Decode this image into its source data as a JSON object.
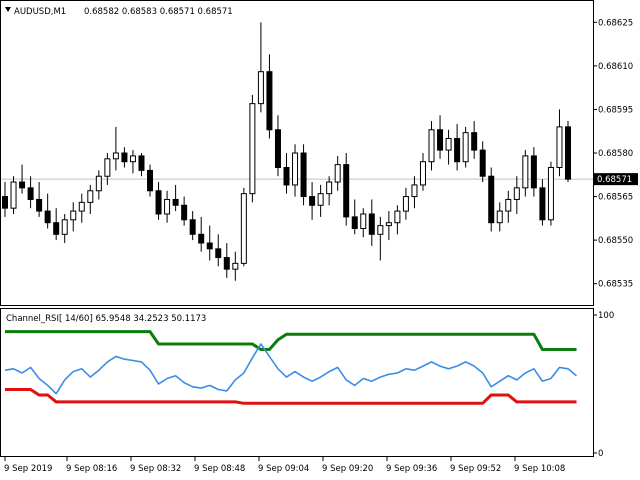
{
  "main": {
    "symbol": "AUDUSD,M1",
    "ohlc": "0.68582 0.68583 0.68571 0.68571",
    "price_axis": [
      "0.68625",
      "0.68610",
      "0.68595",
      "0.68580",
      "0.68565",
      "0.68550",
      "0.68535"
    ],
    "current_price": "0.68571",
    "ylim": [
      0.68528,
      0.68632
    ],
    "current_price_value": 0.68571
  },
  "indicator": {
    "title": "Channel_RSI[ 14/60] 65.9548 34.2523 50.1173",
    "axis_top": "100",
    "axis_bottom": "0",
    "colors": {
      "rsi": "#3a8ee6",
      "upper": "#0a7d0a",
      "lower": "#e01010"
    }
  },
  "time_axis": [
    "9 Sep 2019",
    "9 Sep 08:16",
    "9 Sep 08:32",
    "9 Sep 08:48",
    "9 Sep 09:04",
    "9 Sep 09:20",
    "9 Sep 09:36",
    "9 Sep 09:52",
    "9 Sep 10:08"
  ],
  "chart_data": [
    {
      "type": "candlestick",
      "series": [
        {
          "name": "AUDUSD,M1",
          "values": [
            [
              0.68565,
              0.6857,
              0.68558,
              0.68561
            ],
            [
              0.68561,
              0.68572,
              0.68559,
              0.6857
            ],
            [
              0.6857,
              0.68576,
              0.68566,
              0.68568
            ],
            [
              0.68568,
              0.68572,
              0.68561,
              0.68564
            ],
            [
              0.68564,
              0.6857,
              0.68558,
              0.6856
            ],
            [
              0.6856,
              0.68566,
              0.68554,
              0.68556
            ],
            [
              0.68556,
              0.68561,
              0.6855,
              0.68552
            ],
            [
              0.68552,
              0.68559,
              0.68549,
              0.68557
            ],
            [
              0.68557,
              0.68563,
              0.68553,
              0.6856
            ],
            [
              0.6856,
              0.68566,
              0.68556,
              0.68563
            ],
            [
              0.68563,
              0.68569,
              0.68559,
              0.68567
            ],
            [
              0.68567,
              0.68574,
              0.68564,
              0.68572
            ],
            [
              0.68572,
              0.6858,
              0.68569,
              0.68578
            ],
            [
              0.68578,
              0.68589,
              0.68574,
              0.6858
            ],
            [
              0.6858,
              0.68582,
              0.68575,
              0.68577
            ],
            [
              0.68577,
              0.68581,
              0.68573,
              0.68579
            ],
            [
              0.68579,
              0.6858,
              0.68572,
              0.68574
            ],
            [
              0.68574,
              0.68576,
              0.68565,
              0.68567
            ],
            [
              0.68567,
              0.6857,
              0.68557,
              0.68559
            ],
            [
              0.68559,
              0.68567,
              0.68556,
              0.68564
            ],
            [
              0.68564,
              0.68569,
              0.6856,
              0.68562
            ],
            [
              0.68562,
              0.68565,
              0.68555,
              0.68557
            ],
            [
              0.68557,
              0.6856,
              0.6855,
              0.68552
            ],
            [
              0.68552,
              0.68558,
              0.68546,
              0.68549
            ],
            [
              0.68549,
              0.68555,
              0.68543,
              0.68547
            ],
            [
              0.68547,
              0.68552,
              0.68541,
              0.68544
            ],
            [
              0.68544,
              0.68549,
              0.68537,
              0.6854
            ],
            [
              0.6854,
              0.68546,
              0.68536,
              0.68542
            ],
            [
              0.68542,
              0.68568,
              0.68541,
              0.68566
            ],
            [
              0.68566,
              0.686,
              0.68563,
              0.68597
            ],
            [
              0.68597,
              0.68625,
              0.68594,
              0.68608
            ],
            [
              0.68608,
              0.68614,
              0.68585,
              0.68588
            ],
            [
              0.68588,
              0.68593,
              0.68572,
              0.68575
            ],
            [
              0.68575,
              0.6858,
              0.68566,
              0.68569
            ],
            [
              0.68569,
              0.68583,
              0.68565,
              0.6858
            ],
            [
              0.6858,
              0.68583,
              0.68562,
              0.68565
            ],
            [
              0.68565,
              0.6857,
              0.68557,
              0.68562
            ],
            [
              0.68562,
              0.68569,
              0.68558,
              0.68566
            ],
            [
              0.68566,
              0.68572,
              0.68562,
              0.6857
            ],
            [
              0.6857,
              0.68579,
              0.68567,
              0.68576
            ],
            [
              0.68576,
              0.6858,
              0.68555,
              0.68558
            ],
            [
              0.68558,
              0.68564,
              0.68552,
              0.68554
            ],
            [
              0.68554,
              0.68561,
              0.68551,
              0.68559
            ],
            [
              0.68559,
              0.68564,
              0.68548,
              0.68552
            ],
            [
              0.68552,
              0.68558,
              0.68543,
              0.68555
            ],
            [
              0.68555,
              0.6856,
              0.6855,
              0.68556
            ],
            [
              0.68556,
              0.68562,
              0.68552,
              0.6856
            ],
            [
              0.6856,
              0.68568,
              0.68557,
              0.68565
            ],
            [
              0.68565,
              0.68572,
              0.68561,
              0.68569
            ],
            [
              0.68569,
              0.6858,
              0.68567,
              0.68577
            ],
            [
              0.68577,
              0.68591,
              0.68574,
              0.68588
            ],
            [
              0.68588,
              0.68593,
              0.68578,
              0.68581
            ],
            [
              0.68581,
              0.68588,
              0.68576,
              0.68585
            ],
            [
              0.68585,
              0.6859,
              0.68574,
              0.68577
            ],
            [
              0.68577,
              0.68589,
              0.68575,
              0.68587
            ],
            [
              0.68587,
              0.68591,
              0.68578,
              0.68581
            ],
            [
              0.68581,
              0.68584,
              0.6857,
              0.68572
            ],
            [
              0.68572,
              0.68575,
              0.68553,
              0.68556
            ],
            [
              0.68556,
              0.68563,
              0.68553,
              0.6856
            ],
            [
              0.6856,
              0.68567,
              0.68556,
              0.68564
            ],
            [
              0.68564,
              0.68572,
              0.68559,
              0.68568
            ],
            [
              0.68568,
              0.68581,
              0.68565,
              0.68579
            ],
            [
              0.68579,
              0.68582,
              0.68565,
              0.68568
            ],
            [
              0.68568,
              0.68571,
              0.68555,
              0.68557
            ],
            [
              0.68557,
              0.68577,
              0.68555,
              0.68575
            ],
            [
              0.68575,
              0.68595,
              0.68572,
              0.68589
            ],
            [
              0.68589,
              0.68591,
              0.6857,
              0.68571
            ]
          ]
        }
      ],
      "ylim": [
        0.68528,
        0.68632
      ]
    },
    {
      "type": "line",
      "title": "Channel_RSI[ 14/60]",
      "ylim": [
        0,
        100
      ],
      "series": [
        {
          "values": [
            60,
            61,
            58,
            62,
            54,
            49,
            43,
            53,
            59,
            61,
            55,
            60,
            66,
            70,
            68,
            67,
            66,
            60,
            50,
            54,
            56,
            51,
            48,
            47,
            49,
            46,
            45,
            53,
            58,
            69,
            79,
            70,
            61,
            55,
            59,
            55,
            52,
            55,
            59,
            62,
            53,
            49,
            54,
            52,
            55,
            57,
            58,
            61,
            60,
            63,
            66,
            63,
            61,
            63,
            66,
            63,
            58,
            48,
            52,
            56,
            53,
            58,
            61,
            52,
            54,
            62,
            61,
            56
          ]
        },
        {
          "values": [
            88,
            88,
            88,
            88,
            88,
            88,
            88,
            88,
            88,
            88,
            88,
            88,
            88,
            88,
            88,
            88,
            88,
            88,
            79,
            79,
            79,
            79,
            79,
            79,
            79,
            79,
            79,
            79,
            79,
            79,
            75,
            75,
            82,
            86,
            86,
            86,
            86,
            86,
            86,
            86,
            86,
            86,
            86,
            86,
            86,
            86,
            86,
            86,
            86,
            86,
            86,
            86,
            86,
            86,
            86,
            86,
            86,
            86,
            86,
            86,
            86,
            86,
            86,
            75,
            75,
            75,
            75,
            75
          ]
        },
        {
          "values": [
            46,
            46,
            46,
            46,
            42,
            42,
            37,
            37,
            37,
            37,
            37,
            37,
            37,
            37,
            37,
            37,
            37,
            37,
            37,
            37,
            37,
            37,
            37,
            37,
            37,
            37,
            37,
            37,
            36,
            36,
            36,
            36,
            36,
            36,
            36,
            36,
            36,
            36,
            36,
            36,
            36,
            36,
            36,
            36,
            36,
            36,
            36,
            36,
            36,
            36,
            36,
            36,
            36,
            36,
            36,
            36,
            36,
            42,
            42,
            42,
            37,
            37,
            37,
            37,
            37,
            37,
            37,
            37
          ]
        }
      ]
    }
  ]
}
